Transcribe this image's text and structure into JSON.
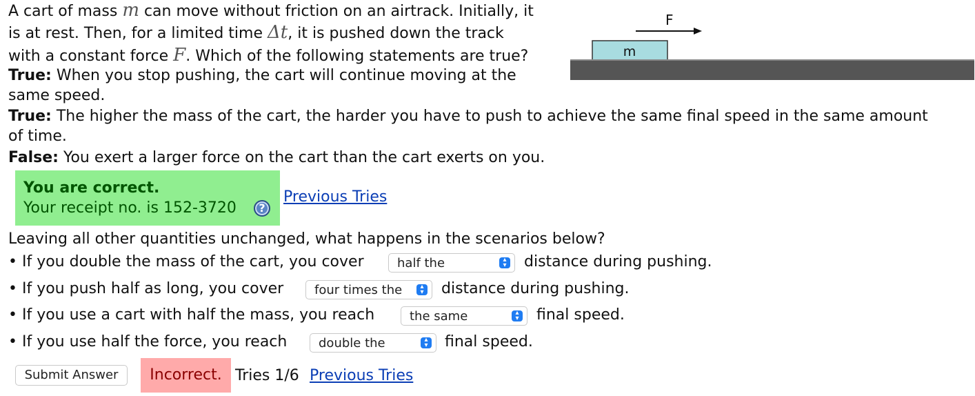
{
  "problem": {
    "line1_a": "A cart of mass ",
    "var_m": "m",
    "line1_b": " can move without friction on an airtrack. Initially, it",
    "line2_a": "is at rest. Then, for a limited time ",
    "var_dt": "Δt",
    "line2_b": ", it is pushed down the track",
    "line3_a": "with a constant force ",
    "var_F": "F",
    "line3_b": ". Which of the following statements are true?",
    "s1_label": "True:",
    "s1_text_a": " When you stop pushing, the cart will continue moving at the",
    "s1_text_b": "same speed.",
    "s2_label": "True:",
    "s2_text_a": " The higher the mass of the cart, the harder you have to push to achieve the same final speed in the same amount",
    "s2_text_b": "of time.",
    "s3_label": "False:",
    "s3_text": " You exert a larger force on the cart than the cart exerts on you."
  },
  "diagram": {
    "force_label": "F",
    "mass_label": "m",
    "cart_color": "#a8dce0",
    "track_color": "#555555"
  },
  "feedback1": {
    "title": "You are correct.",
    "receipt": "Your receipt no. is 152-3720",
    "help_icon": "question-icon",
    "previous_tries": "Previous Tries"
  },
  "scenario": {
    "intro": "Leaving all other quantities unchanged, what happens in the scenarios below?",
    "q1_a": "• If you double the mass of the cart, you cover",
    "q1_select": "half the",
    "q1_b": "distance during pushing.",
    "q2_a": "• If you push half as long, you cover",
    "q2_select": "four times the",
    "q2_b": "distance during pushing.",
    "q3_a": "• If you use a cart with half the mass, you reach",
    "q3_select": "the same",
    "q3_b": "final speed.",
    "q4_a": "• If you use half the force, you reach",
    "q4_select": "double the",
    "q4_b": "final speed."
  },
  "feedback2": {
    "submit_label": "Submit Answer",
    "status": "Incorrect.",
    "tries": "Tries 1/6",
    "previous_tries": "Previous Tries"
  }
}
